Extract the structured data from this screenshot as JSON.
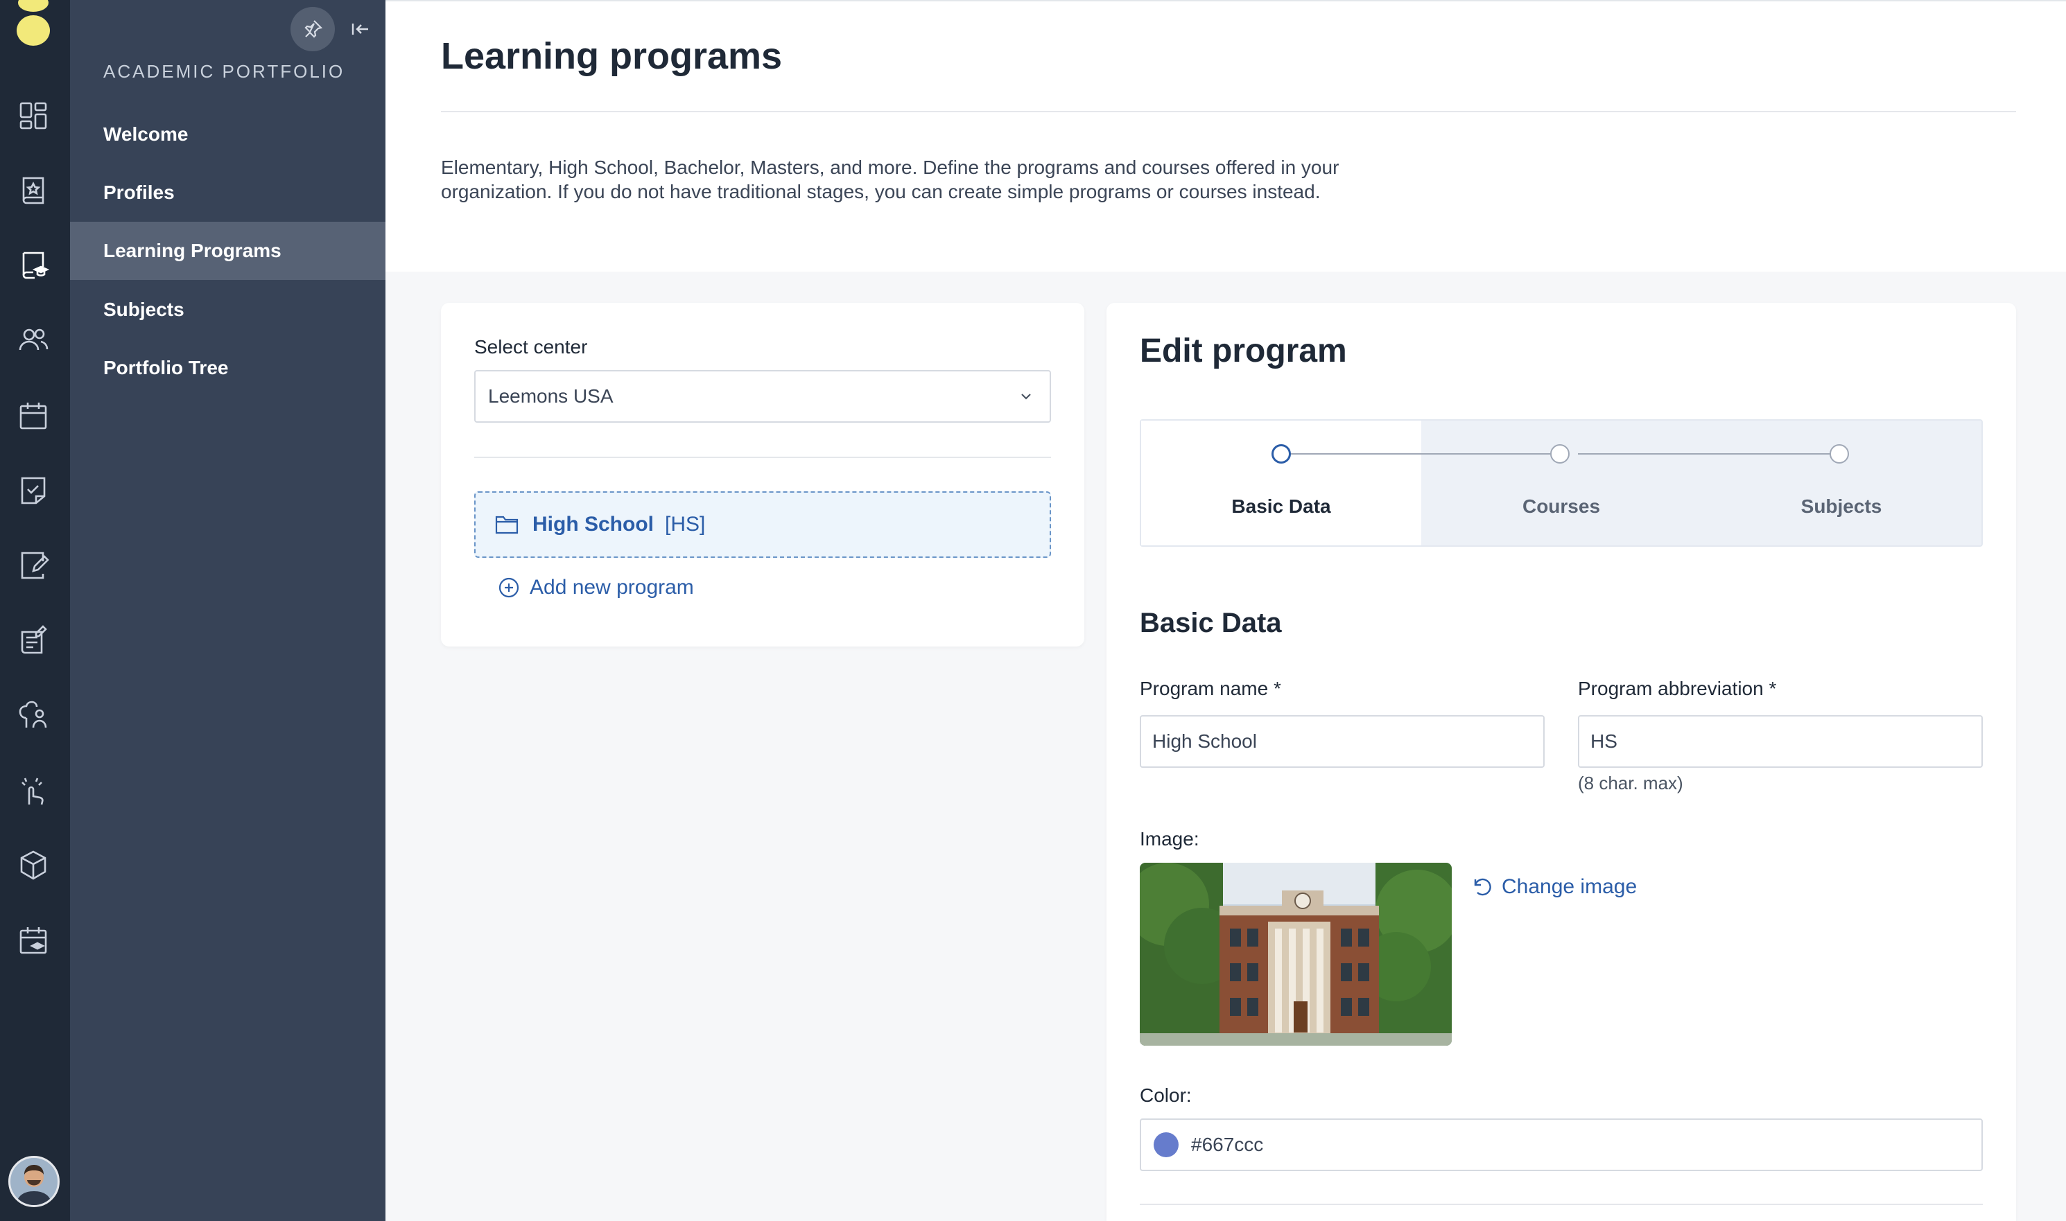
{
  "sidebar": {
    "section_title": "ACADEMIC PORTFOLIO",
    "items": [
      {
        "label": "Welcome"
      },
      {
        "label": "Profiles"
      },
      {
        "label": "Learning Programs",
        "active": true
      },
      {
        "label": "Subjects"
      },
      {
        "label": "Portfolio Tree"
      }
    ]
  },
  "rail": {
    "icons": [
      "dashboard-icon",
      "book-star-icon",
      "book-grad-icon",
      "users-icon",
      "calendar-icon",
      "task-check-icon",
      "edit-note-icon",
      "list-edit-icon",
      "tree-user-icon",
      "hand-tap-icon",
      "cube-icon",
      "calendar-grad-icon"
    ],
    "logo_color": "#f2e97a"
  },
  "header": {
    "title": "Learning programs",
    "description": "Elementary, High School, Bachelor, Masters, and more. Define the programs and courses offered in your organization. If you do not have traditional stages, you can create simple programs or courses instead."
  },
  "left_panel": {
    "select_label": "Select center",
    "select_value": "Leemons USA",
    "program": {
      "name": "High School",
      "abbr": "[HS]"
    },
    "add_label": "Add new program"
  },
  "edit": {
    "title": "Edit program",
    "steps": [
      {
        "label": "Basic Data",
        "active": true
      },
      {
        "label": "Courses"
      },
      {
        "label": "Subjects"
      }
    ],
    "section_title": "Basic Data",
    "name_label": "Program name",
    "name_value": "High School",
    "abbr_label": "Program abbreviation",
    "abbr_value": "HS",
    "abbr_help": "(8 char. max)",
    "required_mark": "*",
    "image_label": "Image:",
    "change_image_label": "Change image",
    "color_label": "Color:",
    "color_value": "#667ccc"
  },
  "colors": {
    "accent": "#2b5da8",
    "sidebar_bg": "#374357",
    "rail_bg": "#1f2937",
    "program_color": "#667ccc"
  }
}
